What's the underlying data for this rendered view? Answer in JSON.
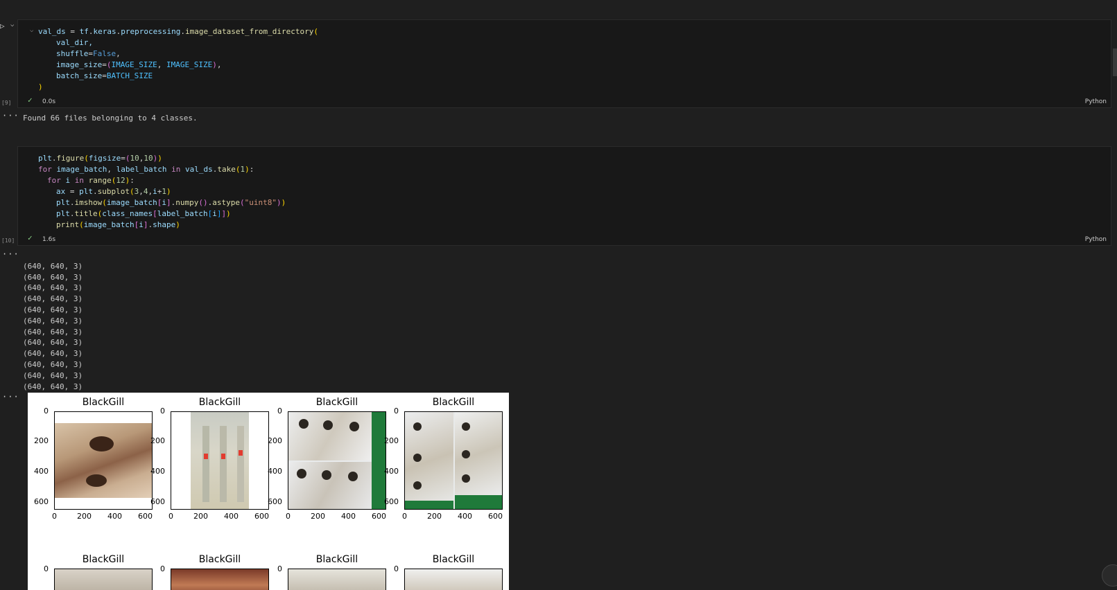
{
  "cells": [
    {
      "exec_count": "[9]",
      "duration": "0.0s",
      "language": "Python",
      "output": "Found 66 files belonging to 4 classes."
    },
    {
      "exec_count": "[10]",
      "duration": "1.6s",
      "language": "Python",
      "output_lines": [
        "(640, 640, 3)",
        "(640, 640, 3)",
        "(640, 640, 3)",
        "(640, 640, 3)",
        "(640, 640, 3)",
        "(640, 640, 3)",
        "(640, 640, 3)",
        "(640, 640, 3)",
        "(640, 640, 3)",
        "(640, 640, 3)",
        "(640, 640, 3)",
        "(640, 640, 3)"
      ]
    }
  ],
  "code1": {
    "l1_a": "val_ds",
    "l1_b": " = ",
    "l1_c": "tf",
    "l1_d": ".",
    "l1_e": "keras",
    "l1_f": ".",
    "l1_g": "preprocessing",
    "l1_h": ".",
    "l1_i": "image_dataset_from_directory",
    "l1_j": "(",
    "l2": "val_dir,",
    "l3_a": "shuffle",
    "l3_b": "=",
    "l3_c": "False",
    "l3_d": ",",
    "l4_a": "image_size",
    "l4_b": "=",
    "l4_c": "(",
    "l4_d": "IMAGE_SIZE",
    "l4_e": ", ",
    "l4_f": "IMAGE_SIZE",
    "l4_g": ")",
    "l4_h": ",",
    "l5_a": "batch_size",
    "l5_b": "=",
    "l5_c": "BATCH_SIZE",
    "l6": ")"
  },
  "code2": {
    "l1_a": "plt",
    "l1_b": ".",
    "l1_c": "figure",
    "l1_d": "(",
    "l1_e": "figsize",
    "l1_f": "=",
    "l1_g": "(",
    "l1_h": "10",
    "l1_i": ",",
    "l1_j": "10",
    "l1_k": ")",
    "l1_l": ")",
    "l2_a": "for",
    "l2_b": " image_batch",
    "l2_c": ", ",
    "l2_d": "label_batch",
    "l2_e": " in ",
    "l2_f": "val_ds",
    "l2_g": ".",
    "l2_h": "take",
    "l2_i": "(",
    "l2_j": "1",
    "l2_k": ")",
    "l2_l": ":",
    "l3_a": "for",
    "l3_b": " i",
    "l3_c": " in ",
    "l3_d": "range",
    "l3_e": "(",
    "l3_f": "12",
    "l3_g": ")",
    "l3_h": ":",
    "l4_a": "ax",
    "l4_b": " = ",
    "l4_c": "plt",
    "l4_d": ".",
    "l4_e": "subplot",
    "l4_f": "(",
    "l4_g": "3",
    "l4_h": ",",
    "l4_i": "4",
    "l4_j": ",",
    "l4_k": "i",
    "l4_l": "+",
    "l4_m": "1",
    "l4_n": ")",
    "l5_a": "plt",
    "l5_b": ".",
    "l5_c": "imshow",
    "l5_d": "(",
    "l5_e": "image_batch",
    "l5_f": "[",
    "l5_g": "i",
    "l5_h": "]",
    "l5_i": ".",
    "l5_j": "numpy",
    "l5_k": "()",
    "l5_l": ".",
    "l5_m": "astype",
    "l5_n": "(",
    "l5_o": "\"uint8\"",
    "l5_p": ")",
    "l5_q": ")",
    "l6_a": "plt",
    "l6_b": ".",
    "l6_c": "title",
    "l6_d": "(",
    "l6_e": "class_names",
    "l6_f": "[",
    "l6_g": "label_batch",
    "l6_h": "[",
    "l6_i": "i",
    "l6_j": "]",
    "l6_k": "]",
    "l6_l": ")",
    "l7_a": "print",
    "l7_b": "(",
    "l7_c": "image_batch",
    "l7_d": "[",
    "l7_e": "i",
    "l7_f": "]",
    "l7_g": ".",
    "l7_h": "shape",
    "l7_i": ")"
  },
  "figure": {
    "titles": [
      "BlackGill",
      "BlackGill",
      "BlackGill",
      "BlackGill",
      "BlackGill",
      "BlackGill",
      "BlackGill",
      "BlackGill"
    ],
    "y_ticks": [
      "0",
      "200",
      "400",
      "600"
    ],
    "x_ticks": [
      "0",
      "200",
      "400",
      "600"
    ],
    "row2_y_tick": "0"
  },
  "ui": {
    "run_icon": "play-icon",
    "chevron": "chevron-down-icon",
    "check": "✓",
    "ellipsis": "···"
  }
}
